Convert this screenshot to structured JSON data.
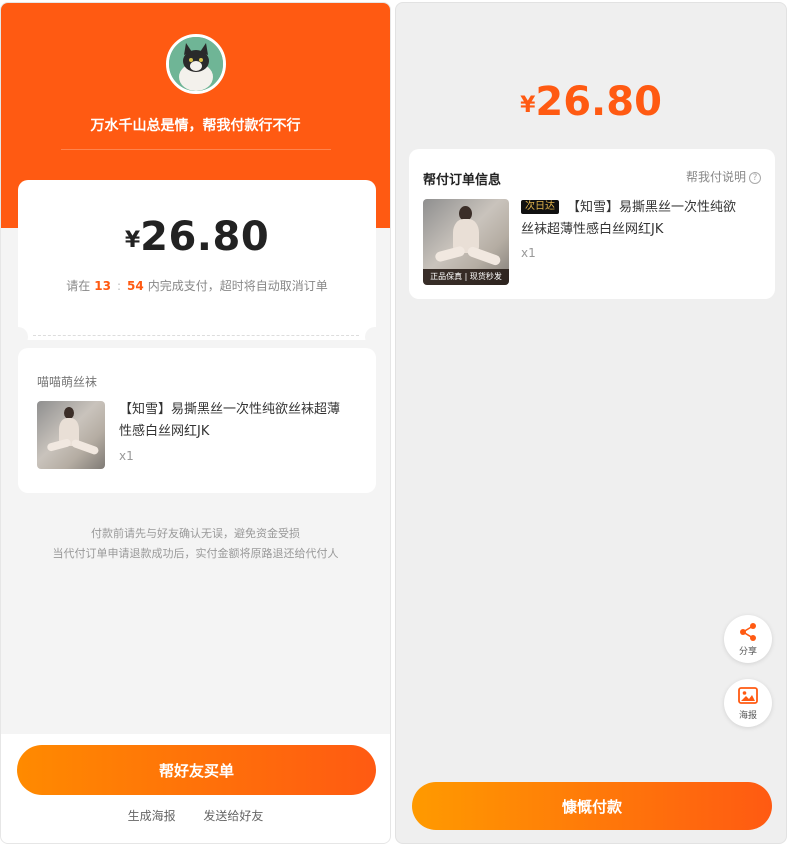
{
  "left": {
    "invite_text": "万水千山总是情，帮我付款行不行",
    "price": {
      "currency": "¥",
      "amount": "26.80"
    },
    "countdown": {
      "prefix": "请在",
      "minutes": "13",
      "separator": ":",
      "seconds": "54",
      "suffix": "内完成支付，超时将自动取消订单"
    },
    "shop_name": "喵喵萌丝袜",
    "goods": {
      "title_line1": "【知雪】易撕黑丝一次性纯欲丝袜超薄",
      "title_line2": "性感白丝网红JK",
      "qty": "x1"
    },
    "tips": {
      "line1": "付款前请先与好友确认无误，避免资金受损",
      "line2": "当代付订单申请退款成功后，实付金额将原路退还给代付人"
    },
    "buy_button": "帮好友买单",
    "links": {
      "poster": "生成海报",
      "send": "发送给好友"
    }
  },
  "right": {
    "price": {
      "currency": "¥",
      "amount": "26.80"
    },
    "card_title": "帮付订单信息",
    "help_link": "帮我付说明",
    "help_icon": "?",
    "badge": "次日达",
    "goods": {
      "title_line1": "【知雪】易撕黑丝一次性纯欲",
      "title_line2": "丝袜超薄性感白丝网红JK",
      "qty": "x1"
    },
    "thumb_strip": "正品保真 | 现货秒发",
    "share_label": "分享",
    "poster_label": "海报",
    "pay_button": "慷慨付款"
  },
  "colors": {
    "brand_orange": "#ff5a12",
    "gradient_start": "#ff8a00",
    "page_bg": "#f4f4f4"
  },
  "icons": [
    "cat-avatar",
    "share-icon",
    "poster-icon",
    "question-icon"
  ]
}
